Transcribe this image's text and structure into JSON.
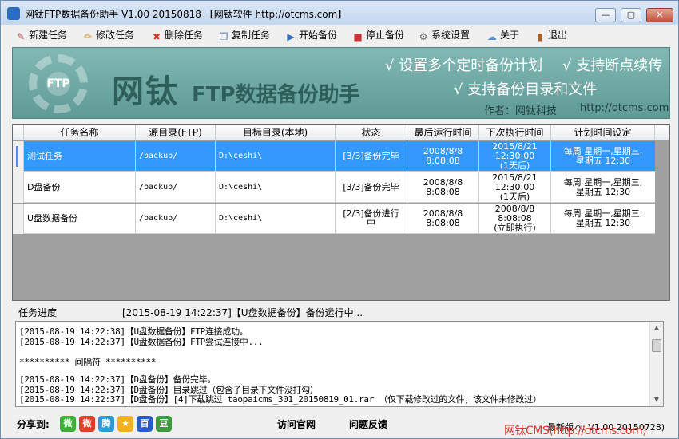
{
  "window": {
    "title": "网钛FTP数据备份助手 V1.00 20150818 【网钛软件 http://otcms.com】",
    "min_label": "—",
    "max_label": "▢",
    "close_label": "✕"
  },
  "toolbar": [
    {
      "label": "新建任务",
      "icon": "new-task-icon",
      "glyph": "✎",
      "color": "#b04a4a"
    },
    {
      "label": "修改任务",
      "icon": "pencil-icon",
      "glyph": "✏",
      "color": "#d08a1a"
    },
    {
      "label": "删除任务",
      "icon": "delete-icon",
      "glyph": "✖",
      "color": "#d03a1a"
    },
    {
      "label": "复制任务",
      "icon": "copy-icon",
      "glyph": "❐",
      "color": "#5a7fb0"
    },
    {
      "label": "开始备份",
      "icon": "play-icon",
      "glyph": "▶",
      "color": "#3a6fc0"
    },
    {
      "label": "停止备份",
      "icon": "stop-icon",
      "glyph": "■",
      "color": "#d0303a"
    },
    {
      "label": "系统设置",
      "icon": "gear-icon",
      "glyph": "⚙",
      "color": "#707070"
    },
    {
      "label": "关于",
      "icon": "chat-icon",
      "glyph": "☁",
      "color": "#5a8fd0"
    },
    {
      "label": "退出",
      "icon": "exit-icon",
      "glyph": "▮",
      "color": "#b06020"
    }
  ],
  "banner": {
    "brand": "网钛",
    "subtitle": "FTP数据备份助手",
    "feature1": "√ 设置多个定时备份计划",
    "feature2": "√ 支持断点续传",
    "feature3": "√ 支持备份目录和文件",
    "author": "作者：网钛科技",
    "url": "http://otcms.com",
    "logo_text": "FTP"
  },
  "table": {
    "headers": [
      "任务名称",
      "源目录(FTP)",
      "目标目录(本地)",
      "状态",
      "最后运行时间",
      "下次执行时间",
      "计划时间设定"
    ],
    "rows": [
      {
        "name": "测试任务",
        "source": "/backup/",
        "target": "D:\\ceshi\\",
        "status": "[3/3]备份完毕",
        "last_run": "2008/8/8\n8:08:08",
        "next_run": "2015/8/21\n12:30:00\n(1天后)",
        "schedule": "每周 星期一,星期三,\n星期五 12:30",
        "selected": true
      },
      {
        "name": "D盘备份",
        "source": "/backup/",
        "target": "D:\\ceshi\\",
        "status": "[3/3]备份完毕",
        "last_run": "2008/8/8\n8:08:08",
        "next_run": "2015/8/21\n12:30:00\n(1天后)",
        "schedule": "每周 星期一,星期三,\n星期五 12:30",
        "selected": false
      },
      {
        "name": "U盘数据备份",
        "source": "/backup/",
        "target": "D:\\ceshi\\",
        "status": "[2/3]备份进行\n中",
        "last_run": "2008/8/8\n8:08:08",
        "next_run": "2008/8/8\n8:08:08\n(立即执行)",
        "schedule": "每周 星期一,星期三,\n星期五 12:30",
        "selected": false
      }
    ]
  },
  "progress": {
    "label": "任务进度",
    "status": "[2015-08-19 14:22:37]【U盘数据备份】备份运行中..."
  },
  "log": [
    "[2015-08-19 14:22:38]【U盘数据备份】FTP连接成功。",
    "[2015-08-19 14:22:37]【U盘数据备份】FTP尝试连接中...",
    "",
    "********** 间隔符 **********",
    "",
    "[2015-08-19 14:22:37]【D盘备份】备份完毕。",
    "[2015-08-19 14:22:37]【D盘备份】目录跳过（包含子目录下文件没打勾）",
    "[2015-08-19 14:22:37]【D盘备份】[4]下载跳过 taopaicms_301_20150819_01.rar （仅下载修改过的文件，该文件未修改过）"
  ],
  "footer": {
    "share_label": "分享到:",
    "share_icons": [
      {
        "name": "wechat-icon",
        "glyph": "微",
        "color": "#3cb034"
      },
      {
        "name": "weibo-icon",
        "glyph": "微",
        "color": "#e0402a"
      },
      {
        "name": "tencent-weibo-icon",
        "glyph": "腾",
        "color": "#2a9ad8"
      },
      {
        "name": "qzone-icon",
        "glyph": "★",
        "color": "#f0b020"
      },
      {
        "name": "baidu-icon",
        "glyph": "百",
        "color": "#2a5cc8"
      },
      {
        "name": "douban-icon",
        "glyph": "豆",
        "color": "#3c9a3c"
      }
    ],
    "visit_site": "访问官网",
    "feedback": "问题反馈",
    "version": "最新版本: V1.00 20150728)",
    "watermark": "网钛CMS(http://otcms.com)"
  }
}
